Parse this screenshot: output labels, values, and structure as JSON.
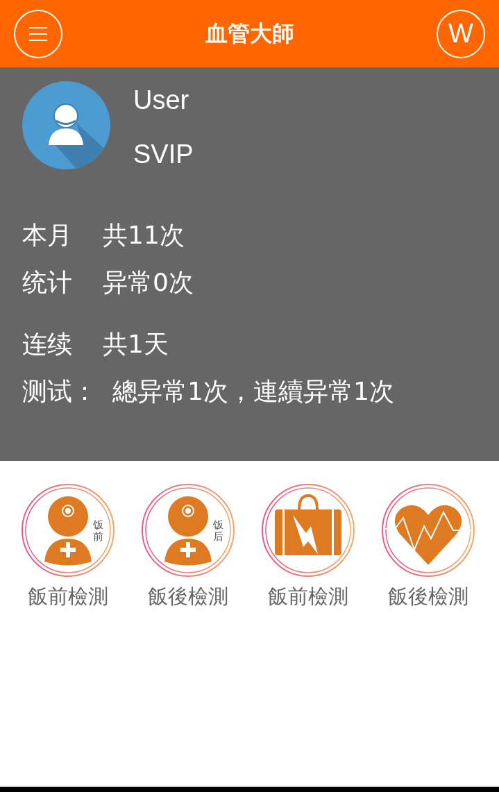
{
  "header": {
    "title": "血管大師",
    "right_button": "W"
  },
  "profile": {
    "name": "User",
    "level": "SVIP"
  },
  "stat_groups": [
    [
      {
        "label": "本月",
        "value": "共11次"
      },
      {
        "label": "统计",
        "value": "异常0次"
      }
    ],
    [
      {
        "label": "连续",
        "value": "共1天"
      },
      {
        "label": "测试：",
        "value": "總异常1次，連續异常1次"
      }
    ]
  ],
  "tiles": [
    {
      "kind": "doctor",
      "badge": "饭前",
      "label": "飯前檢測"
    },
    {
      "kind": "doctor",
      "badge": "饭后",
      "label": "飯後檢測"
    },
    {
      "kind": "bag",
      "label": "飯前檢測"
    },
    {
      "kind": "heart",
      "label": "飯後檢測"
    }
  ]
}
